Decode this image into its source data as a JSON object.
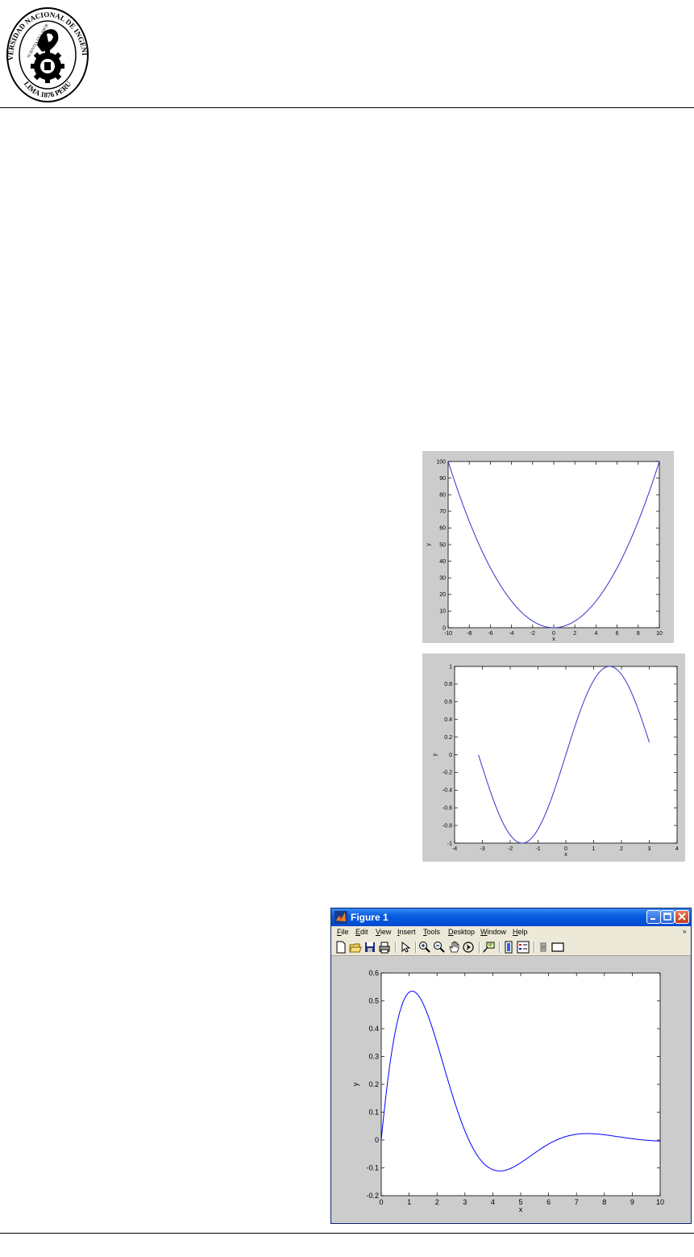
{
  "logo": {
    "text_top": "UNIVERSIDAD NACIONAL DE INGENIERIA",
    "text_bottom": "LIMA 1876 PERU",
    "motto": "SCIENTIA ET LABOR"
  },
  "figures": [
    {
      "type": "line",
      "function": "y = x^2",
      "xlabel": "x",
      "ylabel": "y",
      "xlim": [
        -10,
        10
      ],
      "ylim": [
        0,
        100
      ],
      "xticks": [
        "-10",
        "-8",
        "-6",
        "-4",
        "-2",
        "0",
        "2",
        "4",
        "6",
        "8",
        "10"
      ],
      "yticks": [
        "0",
        "10",
        "20",
        "30",
        "40",
        "50",
        "60",
        "70",
        "80",
        "90",
        "100"
      ],
      "grid": false,
      "line_color": "#3333cc"
    },
    {
      "type": "line",
      "function": "y = sin(x)",
      "xlabel": "x",
      "ylabel": "y",
      "xlim": [
        -4,
        4
      ],
      "ylim": [
        -1,
        1
      ],
      "x_range": [
        -3.1416,
        3.0
      ],
      "xticks": [
        "-4",
        "-3",
        "-2",
        "-1",
        "0",
        "1",
        "2",
        "3",
        "4"
      ],
      "yticks": [
        "-1",
        "-0.8",
        "-0.6",
        "-0.4",
        "-0.2",
        "0",
        "0.2",
        "0.4",
        "0.6",
        "0.8",
        "1"
      ],
      "grid": false,
      "line_color": "#3333cc"
    }
  ],
  "window": {
    "title": "Figure 1",
    "menu": [
      "File",
      "Edit",
      "View",
      "Insert",
      "Tools",
      "Desktop",
      "Window",
      "Help"
    ],
    "overflow": "»",
    "toolbar_icons": [
      "new-figure-icon",
      "open-file-icon",
      "save-icon",
      "print-icon",
      "select-arrow-icon",
      "zoom-in-icon",
      "zoom-out-icon",
      "pan-hand-icon",
      "rotate-3d-icon",
      "data-cursor-icon",
      "colorbar-icon",
      "legend-icon",
      "hide-plot-tools-icon",
      "show-plot-tools-icon"
    ],
    "chart": {
      "type": "line",
      "function": "y = exp(-x/2)·sin(x)",
      "xlabel": "x",
      "ylabel": "y",
      "xlim": [
        0,
        10
      ],
      "ylim": [
        -0.2,
        0.6
      ],
      "xticks": [
        "0",
        "1",
        "2",
        "3",
        "4",
        "5",
        "6",
        "7",
        "8",
        "9",
        "10"
      ],
      "yticks": [
        "-0.2",
        "-0.1",
        "0",
        "0.1",
        "0.2",
        "0.3",
        "0.4",
        "0.5",
        "0.6"
      ],
      "grid": false,
      "line_color": "#0000ff"
    }
  },
  "chart_data": [
    {
      "type": "line",
      "x": [
        -10,
        -8,
        -6,
        -4,
        -2,
        0,
        2,
        4,
        6,
        8,
        10
      ],
      "y": [
        100,
        64,
        36,
        16,
        4,
        0,
        4,
        16,
        36,
        64,
        100
      ],
      "xlabel": "x",
      "ylabel": "y",
      "xlim": [
        -10,
        10
      ],
      "ylim": [
        0,
        100
      ]
    },
    {
      "type": "line",
      "x": [
        -3.14,
        -2.5,
        -2,
        -1.57,
        -1,
        -0.5,
        0,
        0.5,
        1,
        1.57,
        2,
        2.5,
        3
      ],
      "y": [
        0,
        -0.6,
        -0.91,
        -1,
        -0.84,
        -0.48,
        0,
        0.48,
        0.84,
        1,
        0.91,
        0.6,
        0.14
      ],
      "xlabel": "x",
      "ylabel": "y",
      "xlim": [
        -4,
        4
      ],
      "ylim": [
        -1,
        1
      ]
    },
    {
      "type": "line",
      "x": [
        0,
        0.5,
        1,
        1.2,
        1.5,
        2,
        3,
        4,
        4.4,
        5,
        6,
        7,
        7.5,
        8,
        9,
        10
      ],
      "y": [
        0,
        0.37,
        0.51,
        0.51,
        0.47,
        0.33,
        0.03,
        -0.1,
        -0.1,
        -0.08,
        0.0,
        0.02,
        0.02,
        0.02,
        0.005,
        -0.004
      ],
      "xlabel": "x",
      "ylabel": "y",
      "xlim": [
        0,
        10
      ],
      "ylim": [
        -0.2,
        0.6
      ]
    }
  ]
}
